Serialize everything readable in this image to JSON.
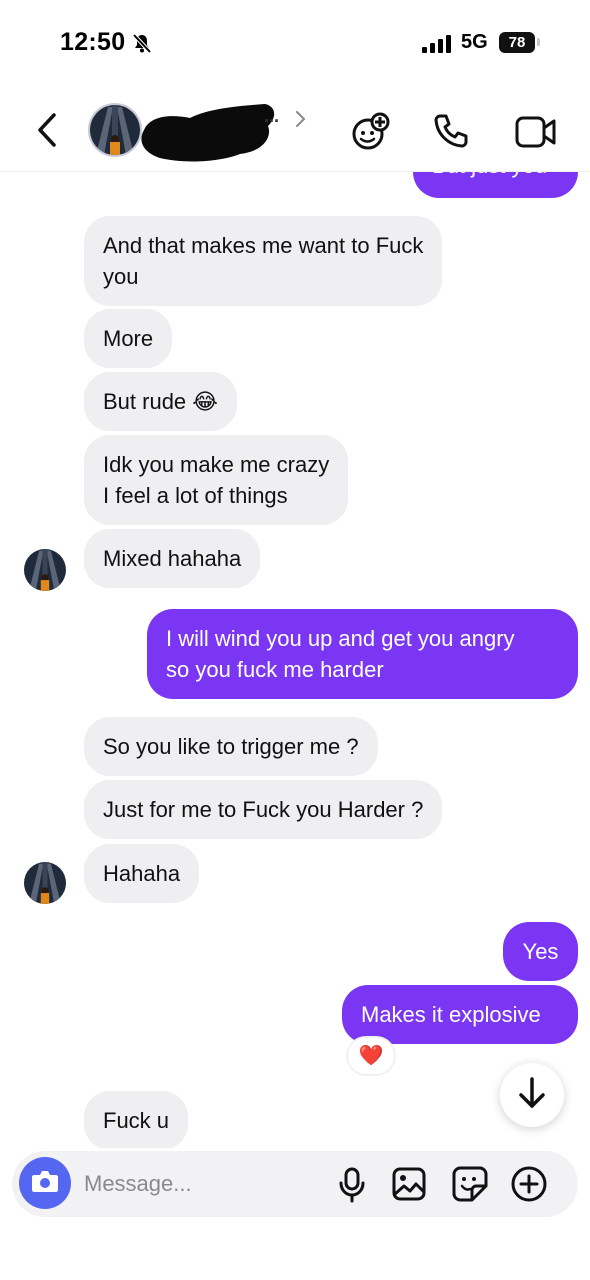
{
  "status_bar": {
    "time": "12:50",
    "network": "5G",
    "battery": "78"
  },
  "header": {
    "name_ellipsis": "...",
    "icons": [
      "back-icon",
      "effects-icon",
      "phone-icon",
      "video-icon"
    ]
  },
  "messages": [
    {
      "direction": "out",
      "text": "But just you",
      "partial": true
    },
    {
      "direction": "in",
      "text": "And that makes me want to Fuck\nyou"
    },
    {
      "direction": "in",
      "text": "More"
    },
    {
      "direction": "in",
      "text": "But rude 😂"
    },
    {
      "direction": "in",
      "text": "Idk you make me crazy\nI feel a lot of things"
    },
    {
      "direction": "in",
      "text": "Mixed hahaha"
    },
    {
      "direction": "out",
      "text": "I will wind you up and get you angry\nso you fuck me harder"
    },
    {
      "direction": "in",
      "text": "So you like to trigger me ?"
    },
    {
      "direction": "in",
      "text": "Just for me to Fuck you Harder ?"
    },
    {
      "direction": "in",
      "text": "Hahaha"
    },
    {
      "direction": "out",
      "text": "Yes"
    },
    {
      "direction": "out",
      "text": "Makes it explosive",
      "reaction": "❤️"
    },
    {
      "direction": "in",
      "text": "Fuck u"
    }
  ],
  "composer": {
    "placeholder": "Message..."
  },
  "colors": {
    "outgoing": "#7a36f3",
    "incoming": "#efeff1",
    "camera": "#5567f0"
  }
}
